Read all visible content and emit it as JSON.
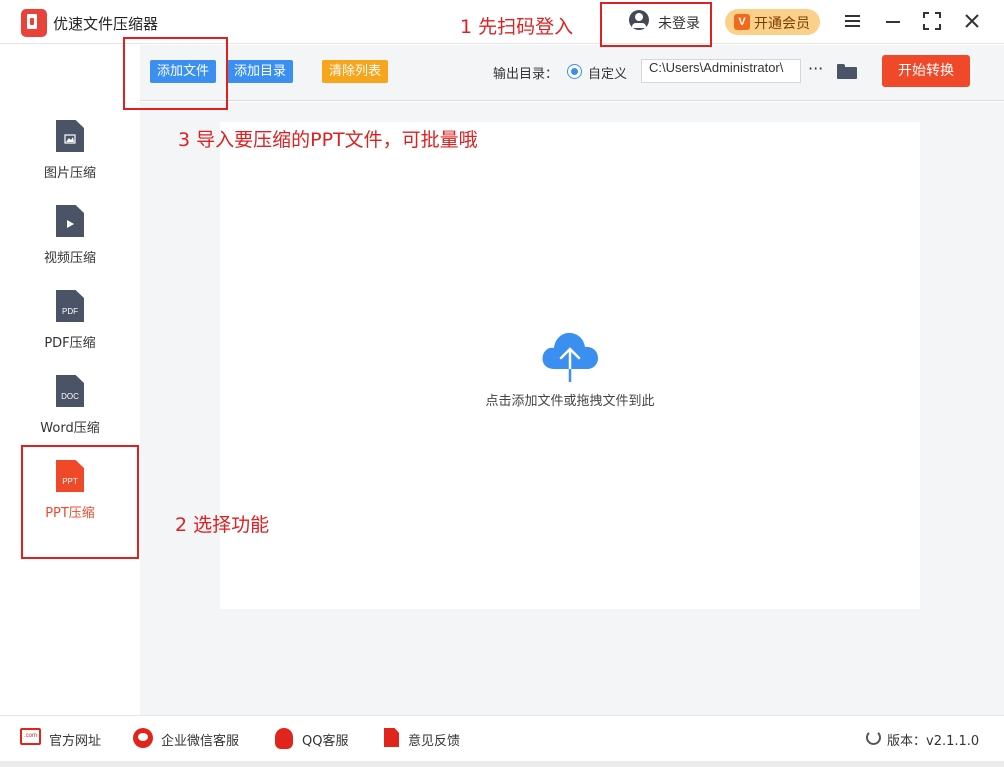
{
  "app": {
    "title": "优速文件压缩器"
  },
  "header": {
    "login_status": "未登录",
    "vip_label": "开通会员",
    "vip_icon_text": "V"
  },
  "toolbar": {
    "add_file": "添加文件",
    "add_dir": "添加目录",
    "clear_list": "清除列表",
    "output_label": "输出目录：",
    "radio_label": "自定义",
    "output_path": "C:\\Users\\Administrator\\",
    "more": "···",
    "start": "开始转换"
  },
  "sidebar": {
    "items": [
      {
        "icon_text": "",
        "label": "图片压缩"
      },
      {
        "icon_text": "",
        "label": "视频压缩"
      },
      {
        "icon_text": "PDF",
        "label": "PDF压缩"
      },
      {
        "icon_text": "DOC",
        "label": "Word压缩"
      },
      {
        "icon_text": "PPT",
        "label": "PPT压缩"
      }
    ]
  },
  "main": {
    "drop_text": "点击添加文件或拖拽文件到此"
  },
  "annotations": {
    "step1": "1 先扫码登入",
    "step2": "2 选择功能",
    "step3": "3 导入要压缩的PPT文件，可批量哦"
  },
  "footer": {
    "website": "官方网址",
    "wechat": "企业微信客服",
    "qq": "QQ客服",
    "feedback": "意见反馈",
    "version": "版本：v2.1.1.0",
    "com_icon_text": ".com"
  },
  "colors": {
    "accent": "#3a8ff0",
    "primary": "#f0492a",
    "annotation": "#e02020"
  }
}
